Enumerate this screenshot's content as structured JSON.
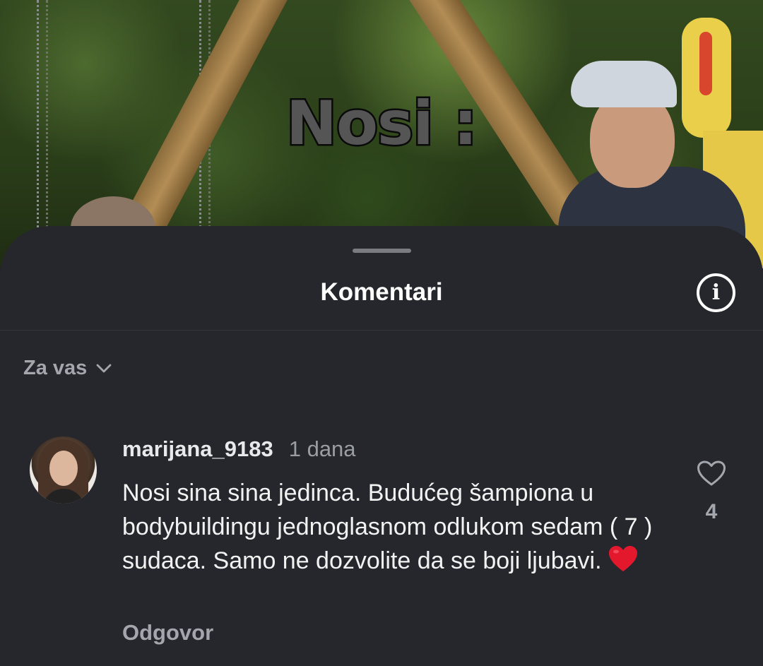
{
  "video": {
    "overlay_text": "Nosi :"
  },
  "sheet": {
    "title": "Komentari",
    "info_icon": "info-icon"
  },
  "filter": {
    "label": "Za vas",
    "icon": "chevron-down-icon"
  },
  "comments": [
    {
      "username": "marijana_9183",
      "time": "1 dana",
      "text": "Nosi sina sina jedinca. Budućeg šampiona u bodybuildingu jednoglasnom odlukom sedam ( 7 ) sudaca. Samo ne dozvolite da se boji ljubavi.",
      "emoji": "red-heart",
      "reply_label": "Odgovor",
      "likes": "4",
      "like_icon": "heart-outline-icon"
    }
  ],
  "colors": {
    "sheet_bg": "#25272c",
    "text_primary": "#f2f2f2",
    "text_secondary": "#a3a6ad",
    "heart_red": "#e3182d"
  }
}
